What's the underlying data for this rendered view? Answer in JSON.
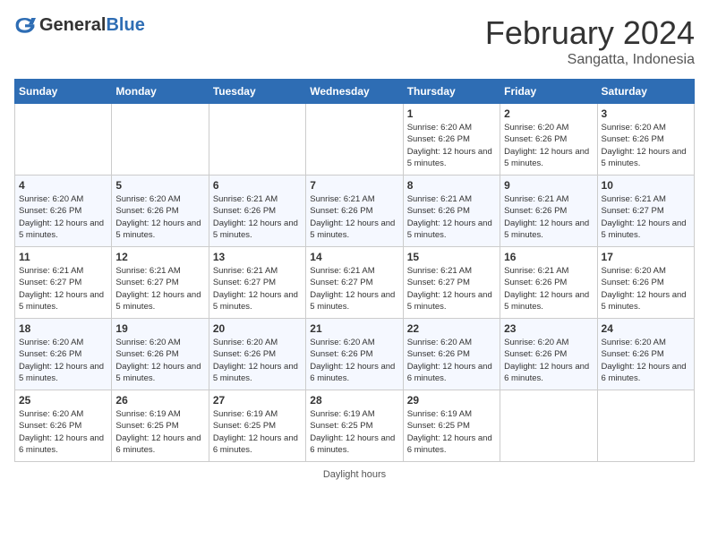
{
  "header": {
    "logo_general": "General",
    "logo_blue": "Blue",
    "title": "February 2024",
    "subtitle": "Sangatta, Indonesia"
  },
  "days_of_week": [
    "Sunday",
    "Monday",
    "Tuesday",
    "Wednesday",
    "Thursday",
    "Friday",
    "Saturday"
  ],
  "weeks": [
    [
      {
        "day": "",
        "info": ""
      },
      {
        "day": "",
        "info": ""
      },
      {
        "day": "",
        "info": ""
      },
      {
        "day": "",
        "info": ""
      },
      {
        "day": "1",
        "info": "Sunrise: 6:20 AM\nSunset: 6:26 PM\nDaylight: 12 hours and 5 minutes."
      },
      {
        "day": "2",
        "info": "Sunrise: 6:20 AM\nSunset: 6:26 PM\nDaylight: 12 hours and 5 minutes."
      },
      {
        "day": "3",
        "info": "Sunrise: 6:20 AM\nSunset: 6:26 PM\nDaylight: 12 hours and 5 minutes."
      }
    ],
    [
      {
        "day": "4",
        "info": "Sunrise: 6:20 AM\nSunset: 6:26 PM\nDaylight: 12 hours and 5 minutes."
      },
      {
        "day": "5",
        "info": "Sunrise: 6:20 AM\nSunset: 6:26 PM\nDaylight: 12 hours and 5 minutes."
      },
      {
        "day": "6",
        "info": "Sunrise: 6:21 AM\nSunset: 6:26 PM\nDaylight: 12 hours and 5 minutes."
      },
      {
        "day": "7",
        "info": "Sunrise: 6:21 AM\nSunset: 6:26 PM\nDaylight: 12 hours and 5 minutes."
      },
      {
        "day": "8",
        "info": "Sunrise: 6:21 AM\nSunset: 6:26 PM\nDaylight: 12 hours and 5 minutes."
      },
      {
        "day": "9",
        "info": "Sunrise: 6:21 AM\nSunset: 6:26 PM\nDaylight: 12 hours and 5 minutes."
      },
      {
        "day": "10",
        "info": "Sunrise: 6:21 AM\nSunset: 6:27 PM\nDaylight: 12 hours and 5 minutes."
      }
    ],
    [
      {
        "day": "11",
        "info": "Sunrise: 6:21 AM\nSunset: 6:27 PM\nDaylight: 12 hours and 5 minutes."
      },
      {
        "day": "12",
        "info": "Sunrise: 6:21 AM\nSunset: 6:27 PM\nDaylight: 12 hours and 5 minutes."
      },
      {
        "day": "13",
        "info": "Sunrise: 6:21 AM\nSunset: 6:27 PM\nDaylight: 12 hours and 5 minutes."
      },
      {
        "day": "14",
        "info": "Sunrise: 6:21 AM\nSunset: 6:27 PM\nDaylight: 12 hours and 5 minutes."
      },
      {
        "day": "15",
        "info": "Sunrise: 6:21 AM\nSunset: 6:27 PM\nDaylight: 12 hours and 5 minutes."
      },
      {
        "day": "16",
        "info": "Sunrise: 6:21 AM\nSunset: 6:26 PM\nDaylight: 12 hours and 5 minutes."
      },
      {
        "day": "17",
        "info": "Sunrise: 6:20 AM\nSunset: 6:26 PM\nDaylight: 12 hours and 5 minutes."
      }
    ],
    [
      {
        "day": "18",
        "info": "Sunrise: 6:20 AM\nSunset: 6:26 PM\nDaylight: 12 hours and 5 minutes."
      },
      {
        "day": "19",
        "info": "Sunrise: 6:20 AM\nSunset: 6:26 PM\nDaylight: 12 hours and 5 minutes."
      },
      {
        "day": "20",
        "info": "Sunrise: 6:20 AM\nSunset: 6:26 PM\nDaylight: 12 hours and 5 minutes."
      },
      {
        "day": "21",
        "info": "Sunrise: 6:20 AM\nSunset: 6:26 PM\nDaylight: 12 hours and 6 minutes."
      },
      {
        "day": "22",
        "info": "Sunrise: 6:20 AM\nSunset: 6:26 PM\nDaylight: 12 hours and 6 minutes."
      },
      {
        "day": "23",
        "info": "Sunrise: 6:20 AM\nSunset: 6:26 PM\nDaylight: 12 hours and 6 minutes."
      },
      {
        "day": "24",
        "info": "Sunrise: 6:20 AM\nSunset: 6:26 PM\nDaylight: 12 hours and 6 minutes."
      }
    ],
    [
      {
        "day": "25",
        "info": "Sunrise: 6:20 AM\nSunset: 6:26 PM\nDaylight: 12 hours and 6 minutes."
      },
      {
        "day": "26",
        "info": "Sunrise: 6:19 AM\nSunset: 6:25 PM\nDaylight: 12 hours and 6 minutes."
      },
      {
        "day": "27",
        "info": "Sunrise: 6:19 AM\nSunset: 6:25 PM\nDaylight: 12 hours and 6 minutes."
      },
      {
        "day": "28",
        "info": "Sunrise: 6:19 AM\nSunset: 6:25 PM\nDaylight: 12 hours and 6 minutes."
      },
      {
        "day": "29",
        "info": "Sunrise: 6:19 AM\nSunset: 6:25 PM\nDaylight: 12 hours and 6 minutes."
      },
      {
        "day": "",
        "info": ""
      },
      {
        "day": "",
        "info": ""
      }
    ]
  ],
  "footer": {
    "label": "Daylight hours"
  }
}
